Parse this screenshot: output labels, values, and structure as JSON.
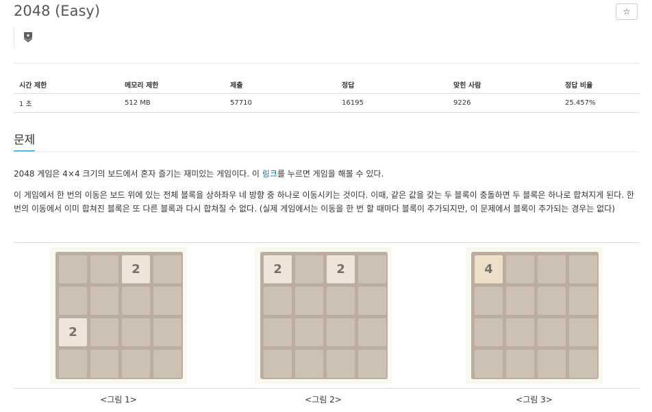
{
  "problem": {
    "title": "2048 (Easy)",
    "star_label": "☆"
  },
  "tier_icon": "silver-tier-badge-icon",
  "stats": {
    "headers": [
      "시간 제한",
      "메모리 제한",
      "제출",
      "정답",
      "맞힌 사람",
      "정답 비율"
    ],
    "values": [
      "1 초",
      "512 MB",
      "57710",
      "16195",
      "9226",
      "25.457%"
    ]
  },
  "section": {
    "heading": "문제",
    "para1_before": "2048 게임은 4×4 크기의 보드에서 혼자 즐기는 재미있는 게임이다. 이 ",
    "para1_link": "링크",
    "para1_after": "를 누르면 게임을 해볼 수 있다.",
    "para2": "이 게임에서 한 번의 이동은 보드 위에 있는 전체 블록을 상하좌우 네 방향 중 하나로 이동시키는 것이다. 이때, 같은 값을 갖는 두 블록이 충돌하면 두 블록은 하나로 합쳐지게 된다. 한 번의 이동에서 이미 합쳐진 블록은 또 다른 블록과 다시 합쳐질 수 없다. (실제 게임에서는 이동을 한 번 할 때마다 블록이 추가되지만, 이 문제에서 블록이 추가되는 경우는 없다)"
  },
  "figures": [
    {
      "caption": "<그림 1>",
      "grid": [
        [
          "",
          "",
          "2",
          ""
        ],
        [
          "",
          "",
          "",
          ""
        ],
        [
          "2",
          "",
          "",
          ""
        ],
        [
          "",
          "",
          "",
          ""
        ]
      ]
    },
    {
      "caption": "<그림 2>",
      "grid": [
        [
          "2",
          "",
          "2",
          ""
        ],
        [
          "",
          "",
          "",
          ""
        ],
        [
          "",
          "",
          "",
          ""
        ],
        [
          "",
          "",
          "",
          ""
        ]
      ]
    },
    {
      "caption": "<그림 3>",
      "grid": [
        [
          "4",
          "",
          "",
          ""
        ],
        [
          "",
          "",
          "",
          ""
        ],
        [
          "",
          "",
          "",
          ""
        ],
        [
          "",
          "",
          "",
          ""
        ]
      ]
    }
  ],
  "colors": {
    "board": "#bbada0",
    "empty_tile": "#cdc1b4",
    "tile_2": "#eee4da",
    "tile_4": "#ede0c8",
    "tile_text": "#776e65",
    "link": "#0e76b8"
  }
}
